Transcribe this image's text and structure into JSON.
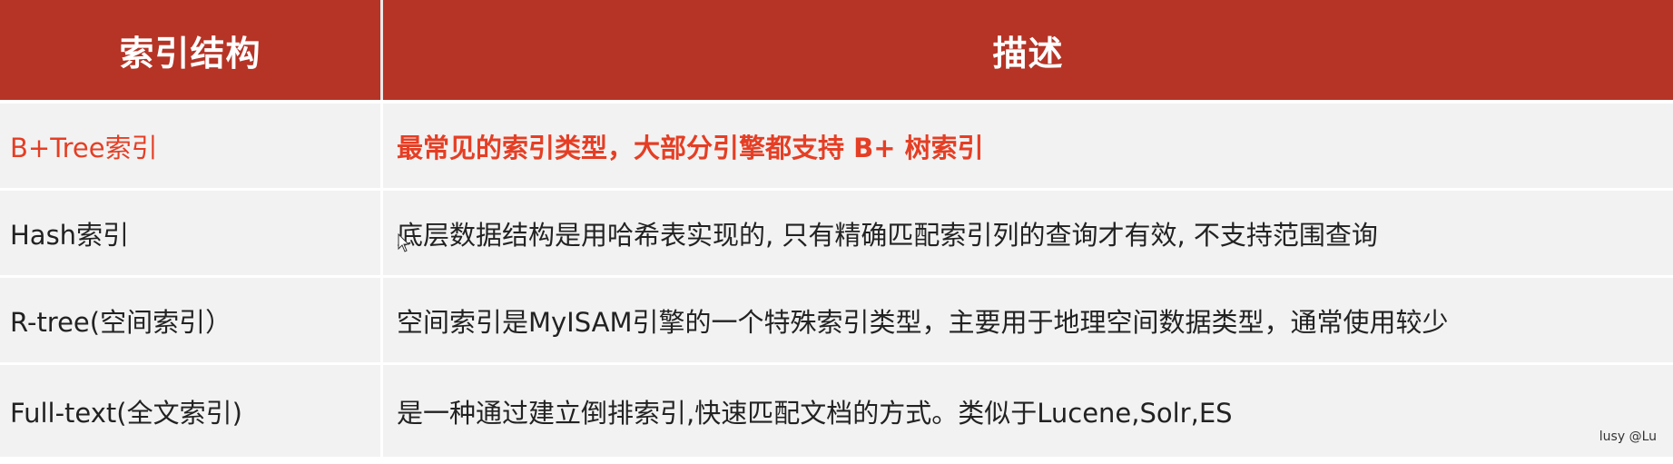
{
  "table": {
    "headers": [
      "索引结构",
      "描述"
    ],
    "rows": [
      {
        "structure": "B+Tree索引",
        "description": "最常见的索引类型，大部分引擎都支持 B+ 树索引",
        "highlighted": true
      },
      {
        "structure": "Hash索引",
        "description": "底层数据结构是用哈希表实现的, 只有精确匹配索引列的查询才有效, 不支持范围查询",
        "highlighted": false
      },
      {
        "structure": "R-tree(空间索引）",
        "description": "空间索引是MyISAM引擎的一个特殊索引类型，主要用于地理空间数据类型，通常使用较少",
        "highlighted": false
      },
      {
        "structure": "Full-text(全文索引)",
        "description": "是一种通过建立倒排索引,快速匹配文档的方式。类似于Lucene,Solr,ES",
        "highlighted": false
      }
    ]
  },
  "watermark": "lusy @Lu",
  "colors": {
    "header_bg": "#b53426",
    "header_text": "#ffffff",
    "row_bg": "#f2f2f2",
    "highlight_text": "#e53e24",
    "body_text": "#222222"
  },
  "cursor_icon": "mouse-pointer-icon"
}
